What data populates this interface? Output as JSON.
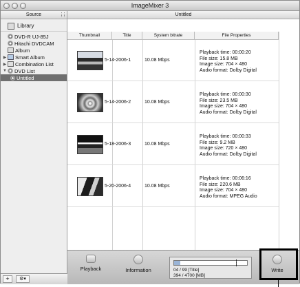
{
  "window": {
    "title": "ImageMixer 3"
  },
  "sidebar": {
    "header": "Source",
    "library": "Library",
    "items": [
      {
        "label": "DVD-R UJ-85J",
        "icon": "disc-icon"
      },
      {
        "label": "Hitachi DVDCAM",
        "icon": "camera-icon"
      },
      {
        "label": "Album",
        "icon": "album-icon"
      },
      {
        "label": "Smart Album",
        "icon": "smart-album-icon",
        "expandable": true
      },
      {
        "label": "Combination List",
        "icon": "combination-list-icon",
        "expandable": true
      },
      {
        "label": "DVD List",
        "icon": "dvd-list-icon",
        "expanded": true
      },
      {
        "label": "Untitled",
        "icon": "disc-small-icon",
        "selected": true
      }
    ],
    "footer": {
      "add": "+",
      "actions": "⚙▾"
    }
  },
  "main": {
    "header": "Untitled",
    "columns": [
      "Thumbnail",
      "Title",
      "System bitrate",
      "File Properties"
    ],
    "rows": [
      {
        "title": "5-14-2006-1",
        "bitrate": "10.08 Mbps",
        "props": [
          "Playback time: 00:00:20",
          "File size: 15.8 MB",
          "Image size: 704 × 480",
          "Audio format: Dolby Digital"
        ]
      },
      {
        "title": "5-14-2006-2",
        "bitrate": "10.08 Mbps",
        "props": [
          "Playback time: 00:00:30",
          "File size: 23.5 MB",
          "Image size: 704 × 480",
          "Audio format: Dolby Digital"
        ]
      },
      {
        "title": "5-18-2006-3",
        "bitrate": "10.08 Mbps",
        "props": [
          "Playback time: 00:00:33",
          "File size: 9.2 MB",
          "Image size: 720 × 480",
          "Audio format: Dolby Digital"
        ]
      },
      {
        "title": "5-20-2006-4",
        "bitrate": "10.08 Mbps",
        "props": [
          "Playback time: 00:06:16",
          "File size: 220.6 MB",
          "Image size: 704 × 480",
          "Audio format: MPEG Audio"
        ]
      }
    ]
  },
  "toolbar": {
    "playback": "Playback",
    "information": "Information",
    "titles_count": "04 / 99 [Title]",
    "capacity_mb": "394 / 4700 [MB]",
    "capacity_fraction": 0.084,
    "write": "Write"
  }
}
